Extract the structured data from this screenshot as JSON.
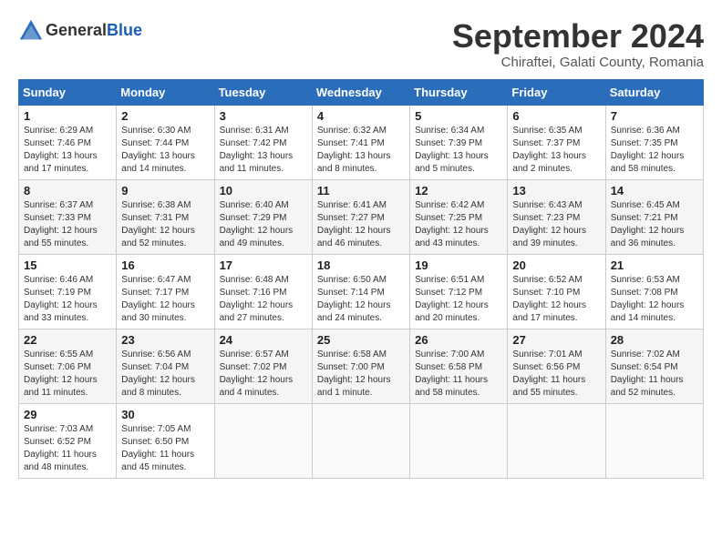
{
  "header": {
    "logo_general": "General",
    "logo_blue": "Blue",
    "month_title": "September 2024",
    "subtitle": "Chiraftei, Galati County, Romania"
  },
  "columns": [
    "Sunday",
    "Monday",
    "Tuesday",
    "Wednesday",
    "Thursday",
    "Friday",
    "Saturday"
  ],
  "weeks": [
    [
      {
        "day": "1",
        "sunrise": "Sunrise: 6:29 AM",
        "sunset": "Sunset: 7:46 PM",
        "daylight": "Daylight: 13 hours and 17 minutes."
      },
      {
        "day": "2",
        "sunrise": "Sunrise: 6:30 AM",
        "sunset": "Sunset: 7:44 PM",
        "daylight": "Daylight: 13 hours and 14 minutes."
      },
      {
        "day": "3",
        "sunrise": "Sunrise: 6:31 AM",
        "sunset": "Sunset: 7:42 PM",
        "daylight": "Daylight: 13 hours and 11 minutes."
      },
      {
        "day": "4",
        "sunrise": "Sunrise: 6:32 AM",
        "sunset": "Sunset: 7:41 PM",
        "daylight": "Daylight: 13 hours and 8 minutes."
      },
      {
        "day": "5",
        "sunrise": "Sunrise: 6:34 AM",
        "sunset": "Sunset: 7:39 PM",
        "daylight": "Daylight: 13 hours and 5 minutes."
      },
      {
        "day": "6",
        "sunrise": "Sunrise: 6:35 AM",
        "sunset": "Sunset: 7:37 PM",
        "daylight": "Daylight: 13 hours and 2 minutes."
      },
      {
        "day": "7",
        "sunrise": "Sunrise: 6:36 AM",
        "sunset": "Sunset: 7:35 PM",
        "daylight": "Daylight: 12 hours and 58 minutes."
      }
    ],
    [
      {
        "day": "8",
        "sunrise": "Sunrise: 6:37 AM",
        "sunset": "Sunset: 7:33 PM",
        "daylight": "Daylight: 12 hours and 55 minutes."
      },
      {
        "day": "9",
        "sunrise": "Sunrise: 6:38 AM",
        "sunset": "Sunset: 7:31 PM",
        "daylight": "Daylight: 12 hours and 52 minutes."
      },
      {
        "day": "10",
        "sunrise": "Sunrise: 6:40 AM",
        "sunset": "Sunset: 7:29 PM",
        "daylight": "Daylight: 12 hours and 49 minutes."
      },
      {
        "day": "11",
        "sunrise": "Sunrise: 6:41 AM",
        "sunset": "Sunset: 7:27 PM",
        "daylight": "Daylight: 12 hours and 46 minutes."
      },
      {
        "day": "12",
        "sunrise": "Sunrise: 6:42 AM",
        "sunset": "Sunset: 7:25 PM",
        "daylight": "Daylight: 12 hours and 43 minutes."
      },
      {
        "day": "13",
        "sunrise": "Sunrise: 6:43 AM",
        "sunset": "Sunset: 7:23 PM",
        "daylight": "Daylight: 12 hours and 39 minutes."
      },
      {
        "day": "14",
        "sunrise": "Sunrise: 6:45 AM",
        "sunset": "Sunset: 7:21 PM",
        "daylight": "Daylight: 12 hours and 36 minutes."
      }
    ],
    [
      {
        "day": "15",
        "sunrise": "Sunrise: 6:46 AM",
        "sunset": "Sunset: 7:19 PM",
        "daylight": "Daylight: 12 hours and 33 minutes."
      },
      {
        "day": "16",
        "sunrise": "Sunrise: 6:47 AM",
        "sunset": "Sunset: 7:17 PM",
        "daylight": "Daylight: 12 hours and 30 minutes."
      },
      {
        "day": "17",
        "sunrise": "Sunrise: 6:48 AM",
        "sunset": "Sunset: 7:16 PM",
        "daylight": "Daylight: 12 hours and 27 minutes."
      },
      {
        "day": "18",
        "sunrise": "Sunrise: 6:50 AM",
        "sunset": "Sunset: 7:14 PM",
        "daylight": "Daylight: 12 hours and 24 minutes."
      },
      {
        "day": "19",
        "sunrise": "Sunrise: 6:51 AM",
        "sunset": "Sunset: 7:12 PM",
        "daylight": "Daylight: 12 hours and 20 minutes."
      },
      {
        "day": "20",
        "sunrise": "Sunrise: 6:52 AM",
        "sunset": "Sunset: 7:10 PM",
        "daylight": "Daylight: 12 hours and 17 minutes."
      },
      {
        "day": "21",
        "sunrise": "Sunrise: 6:53 AM",
        "sunset": "Sunset: 7:08 PM",
        "daylight": "Daylight: 12 hours and 14 minutes."
      }
    ],
    [
      {
        "day": "22",
        "sunrise": "Sunrise: 6:55 AM",
        "sunset": "Sunset: 7:06 PM",
        "daylight": "Daylight: 12 hours and 11 minutes."
      },
      {
        "day": "23",
        "sunrise": "Sunrise: 6:56 AM",
        "sunset": "Sunset: 7:04 PM",
        "daylight": "Daylight: 12 hours and 8 minutes."
      },
      {
        "day": "24",
        "sunrise": "Sunrise: 6:57 AM",
        "sunset": "Sunset: 7:02 PM",
        "daylight": "Daylight: 12 hours and 4 minutes."
      },
      {
        "day": "25",
        "sunrise": "Sunrise: 6:58 AM",
        "sunset": "Sunset: 7:00 PM",
        "daylight": "Daylight: 12 hours and 1 minute."
      },
      {
        "day": "26",
        "sunrise": "Sunrise: 7:00 AM",
        "sunset": "Sunset: 6:58 PM",
        "daylight": "Daylight: 11 hours and 58 minutes."
      },
      {
        "day": "27",
        "sunrise": "Sunrise: 7:01 AM",
        "sunset": "Sunset: 6:56 PM",
        "daylight": "Daylight: 11 hours and 55 minutes."
      },
      {
        "day": "28",
        "sunrise": "Sunrise: 7:02 AM",
        "sunset": "Sunset: 6:54 PM",
        "daylight": "Daylight: 11 hours and 52 minutes."
      }
    ],
    [
      {
        "day": "29",
        "sunrise": "Sunrise: 7:03 AM",
        "sunset": "Sunset: 6:52 PM",
        "daylight": "Daylight: 11 hours and 48 minutes."
      },
      {
        "day": "30",
        "sunrise": "Sunrise: 7:05 AM",
        "sunset": "Sunset: 6:50 PM",
        "daylight": "Daylight: 11 hours and 45 minutes."
      },
      null,
      null,
      null,
      null,
      null
    ]
  ]
}
